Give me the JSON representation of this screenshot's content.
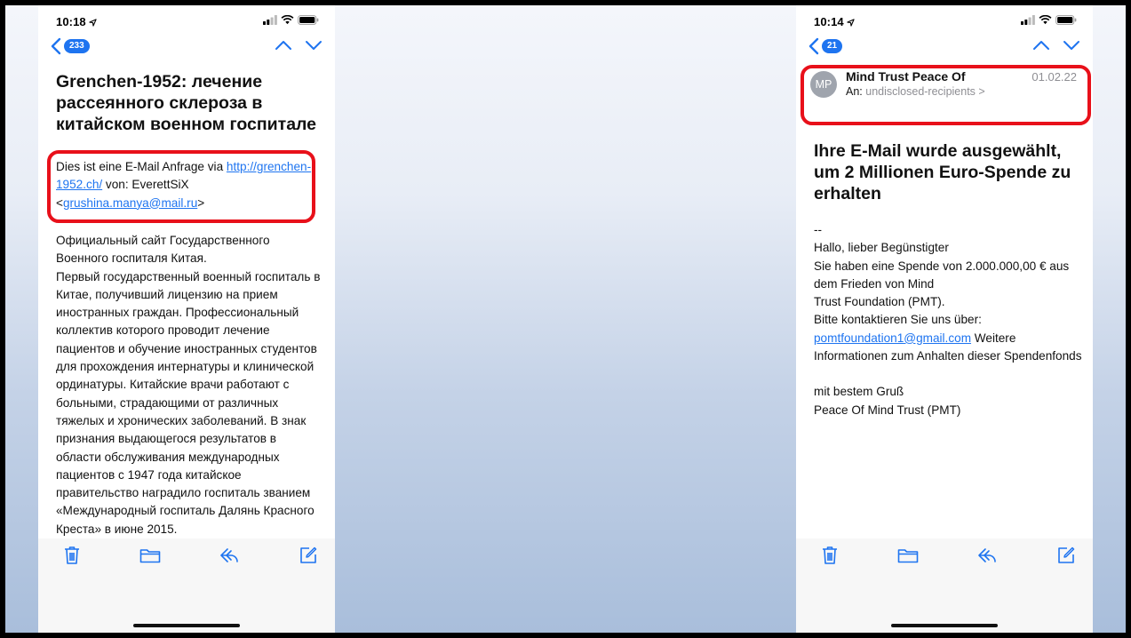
{
  "left_phone": {
    "time": "10:18",
    "unread_count": "233",
    "subject": "Grenchen-1952: лечение рассеянного склероза в китайском военном госпитале",
    "intro_prefix": "Dies ist eine E-Mail Anfrage via ",
    "intro_link": "http://grenchen-1952.ch/",
    "intro_mid": " von: EverettSiX <",
    "intro_email": "grushina.manya@mail.ru",
    "intro_suffix": ">",
    "body": "Официальный сайт Государственного Военного госпиталя Китая.\nПервый государственный военный госпиталь в Китае, получивший лицензию на прием иностранных граждан. Профессиональный коллектив которого проводит лечение пациентов и обучение иностранных студентов для прохождения интернатуры и клинической ординатуры. Китайские врачи работают с больными, страдающими от различных тяжелых и хронических заболеваний. В знак признания выдающегося результатов в области обслуживания международных пациентов с 1947 года китайское правительство наградило госпиталь званием «Международный госпиталь Далянь Красного Креста» в июне 2015."
  },
  "right_phone": {
    "time": "10:14",
    "unread_count": "21",
    "avatar_initials": "MP",
    "sender_name": "Mind Trust Peace Of",
    "date": "01.02.22",
    "recipient_label": "An:",
    "recipient_value": "undisclosed-recipients >",
    "subject": "Ihre E-Mail wurde ausgewählt, um 2 Millionen Euro-Spende zu erhalten",
    "body_top": "--\nHallo, lieber Begünstigter\nSie haben eine Spende von 2.000.000,00 € aus dem Frieden von Mind\nTrust Foundation (PMT).\nBitte kontaktieren Sie uns über:\n",
    "contact_email": "pomtfoundation1@gmail.com",
    "body_after_email": " Weitere Informationen zum Anhalten dieser Spendenfonds",
    "signoff": "mit bestem Gruß\nPeace Of Mind Trust (PMT)"
  },
  "icons": {
    "location": "location-arrow-icon",
    "signal": "signal-bars-icon",
    "wifi": "wifi-icon",
    "battery": "battery-icon",
    "back": "chevron-left-icon",
    "prev": "chevron-up-icon",
    "next": "chevron-down-icon",
    "trash": "trash-icon",
    "folder": "folder-icon",
    "reply": "reply-icon",
    "compose": "compose-icon"
  },
  "colors": {
    "accent": "#1e74f0",
    "highlight": "#e8101a",
    "toolbar_icons": "#1e74f0"
  }
}
